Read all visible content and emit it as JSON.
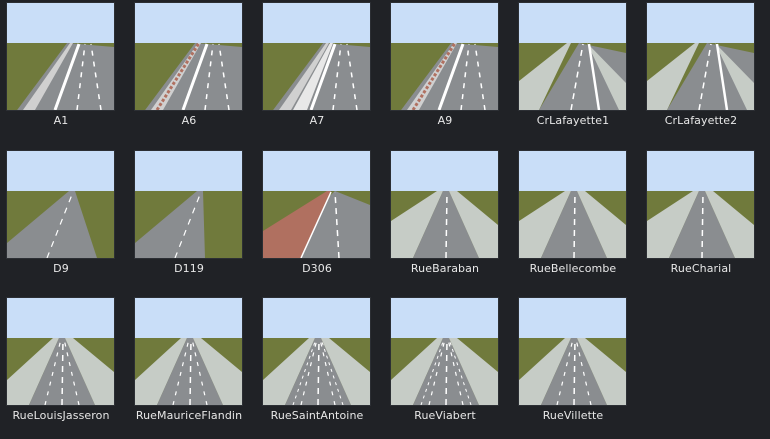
{
  "colors": {
    "background": "#202226",
    "sky": "#c9def8",
    "grass": "#707a3c",
    "asphalt": "#8a8d90",
    "sidewalk": "#c6ccc6",
    "bike_lane": "#b07060",
    "label_text": "#e8e8e8"
  },
  "road_presets": [
    {
      "label": "A1",
      "icon": "motorway-guardrail-icon",
      "style": "motorway"
    },
    {
      "label": "A6",
      "icon": "motorway-barrier-icon",
      "style": "motorway-barrier"
    },
    {
      "label": "A7",
      "icon": "motorway-median-icon",
      "style": "motorway-median"
    },
    {
      "label": "A9",
      "icon": "motorway-barrier-icon",
      "style": "motorway-barrier"
    },
    {
      "label": "CrLafayette1",
      "icon": "boulevard-icon",
      "style": "boulevard"
    },
    {
      "label": "CrLafayette2",
      "icon": "boulevard-icon",
      "style": "boulevard"
    },
    {
      "label": "D9",
      "icon": "rural-road-icon",
      "style": "rural"
    },
    {
      "label": "D119",
      "icon": "rural-road-icon",
      "style": "rural-narrow"
    },
    {
      "label": "D306",
      "icon": "bike-lane-road-icon",
      "style": "bike"
    },
    {
      "label": "RueBaraban",
      "icon": "urban-street-icon",
      "style": "street"
    },
    {
      "label": "RueBellecombe",
      "icon": "urban-street-icon",
      "style": "street"
    },
    {
      "label": "RueCharial",
      "icon": "urban-street-icon",
      "style": "street"
    },
    {
      "label": "RueLouisJasseron",
      "icon": "urban-street-icon",
      "style": "street-wide"
    },
    {
      "label": "RueMauriceFlandin",
      "icon": "urban-street-icon",
      "style": "street-wide"
    },
    {
      "label": "RueSaintAntoine",
      "icon": "urban-street-icon",
      "style": "street-multi"
    },
    {
      "label": "RueViabert",
      "icon": "urban-street-icon",
      "style": "street-multi"
    },
    {
      "label": "RueVillette",
      "icon": "urban-street-icon",
      "style": "street-wide"
    }
  ]
}
